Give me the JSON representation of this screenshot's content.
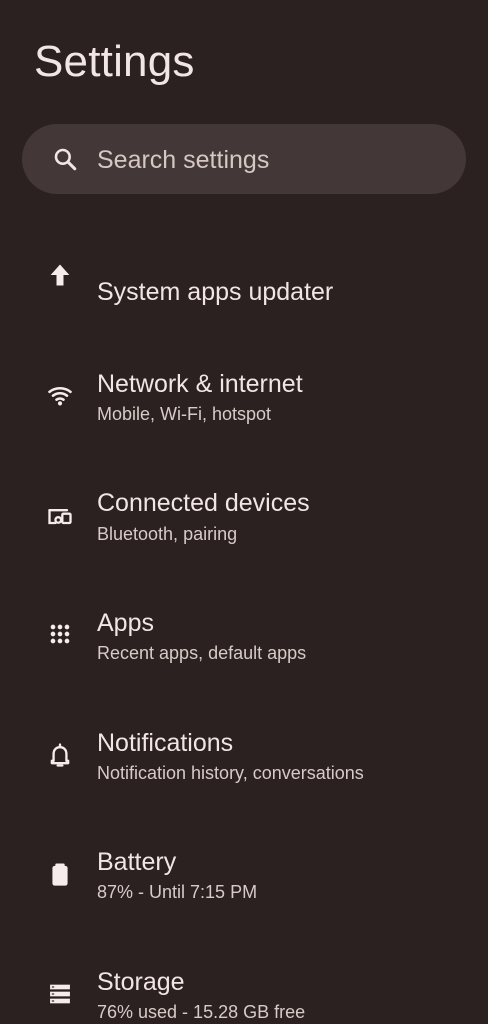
{
  "page": {
    "title": "Settings"
  },
  "search": {
    "placeholder": "Search settings",
    "icon": "search-icon"
  },
  "items": [
    {
      "title": "System apps updater",
      "subtitle": "",
      "icon": "arrow-up-icon"
    },
    {
      "title": "Network & internet",
      "subtitle": "Mobile, Wi-Fi, hotspot",
      "icon": "wifi-icon"
    },
    {
      "title": "Connected devices",
      "subtitle": "Bluetooth, pairing",
      "icon": "devices-icon"
    },
    {
      "title": "Apps",
      "subtitle": "Recent apps, default apps",
      "icon": "apps-grid-icon"
    },
    {
      "title": "Notifications",
      "subtitle": "Notification history, conversations",
      "icon": "bell-icon"
    },
    {
      "title": "Battery",
      "subtitle": "87% - Until 7:15 PM",
      "icon": "battery-icon"
    },
    {
      "title": "Storage",
      "subtitle": "76% used - 15.28 GB free",
      "icon": "storage-icon"
    }
  ],
  "colors": {
    "background": "#2a2120",
    "search_background": "#433837",
    "primary_text": "#f1e6e3",
    "secondary_text": "#d8cbc7"
  }
}
